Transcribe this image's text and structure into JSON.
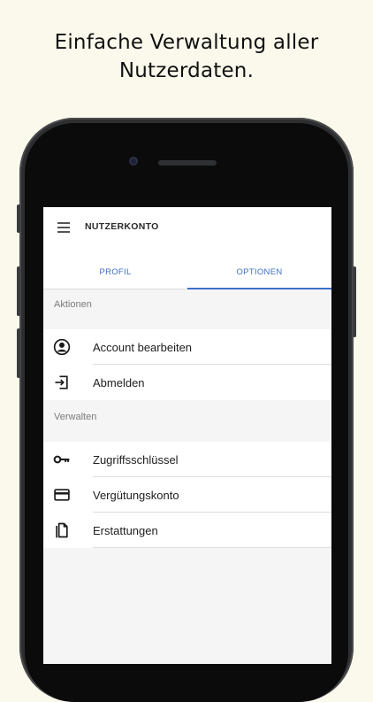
{
  "headline": {
    "line1": "Einfache Verwaltung aller",
    "line2": "Nutzerdaten."
  },
  "app": {
    "title": "NUTZERKONTO",
    "tabs": [
      {
        "label": "PROFIL",
        "active": false
      },
      {
        "label": "OPTIONEN",
        "active": true
      }
    ],
    "sections": [
      {
        "label": "Aktionen",
        "items": [
          {
            "label": "Account bearbeiten",
            "icon": "account-circle-icon"
          },
          {
            "label": "Abmelden",
            "icon": "logout-icon"
          }
        ]
      },
      {
        "label": "Verwalten",
        "items": [
          {
            "label": "Zugriffsschlüssel",
            "icon": "key-icon"
          },
          {
            "label": "Vergütungskonto",
            "icon": "credit-card-icon"
          },
          {
            "label": "Erstattungen",
            "icon": "document-icon"
          }
        ]
      }
    ]
  },
  "colors": {
    "background": "#fbf9ec",
    "accent": "#3c6fc9"
  }
}
